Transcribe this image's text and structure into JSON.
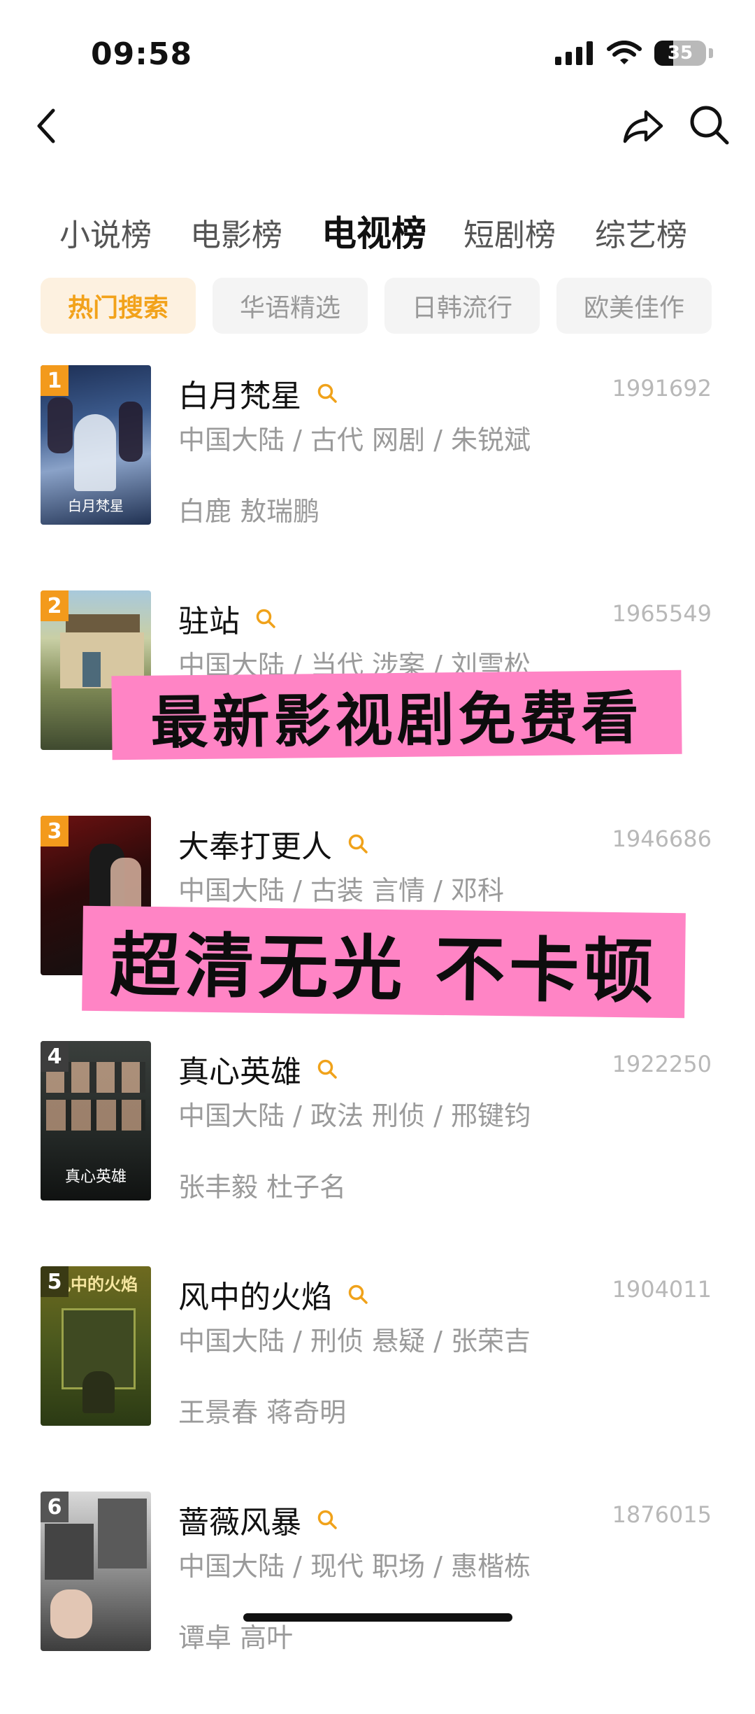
{
  "status_bar": {
    "time": "09:58",
    "battery": "35"
  },
  "nav": {
    "back_icon": "chevron-left-icon",
    "share_icon": "share-icon",
    "search_icon": "search-icon"
  },
  "main_tabs": [
    {
      "label": "小说榜",
      "active": false
    },
    {
      "label": "电影榜",
      "active": false
    },
    {
      "label": "电视榜",
      "active": true
    },
    {
      "label": "短剧榜",
      "active": false
    },
    {
      "label": "综艺榜",
      "active": false
    }
  ],
  "sub_tabs": [
    {
      "label": "热门搜索",
      "active": true
    },
    {
      "label": "华语精选",
      "active": false
    },
    {
      "label": "日韩流行",
      "active": false
    },
    {
      "label": "欧美佳作",
      "active": false
    }
  ],
  "items": [
    {
      "rank": "1",
      "title": "白月梵星",
      "count": "1991692",
      "meta": "中国大陆 / 古代 网剧 / 朱锐斌",
      "cast": "白鹿 敖瑞鹏",
      "poster_text": "白月梵星"
    },
    {
      "rank": "2",
      "title": "驻站",
      "count": "1965549",
      "meta": "中国大陆 / 当代 涉案 / 刘雪松",
      "cast": "",
      "poster_text": ""
    },
    {
      "rank": "3",
      "title": "大奉打更人",
      "count": "1946686",
      "meta": "中国大陆 / 古装 言情 / 邓科",
      "cast": "",
      "poster_text": ""
    },
    {
      "rank": "4",
      "title": "真心英雄",
      "count": "1922250",
      "meta": "中国大陆 / 政法 刑侦 / 邢键钧",
      "cast": "张丰毅 杜子名",
      "poster_text": "真心英雄"
    },
    {
      "rank": "5",
      "title": "风中的火焰",
      "count": "1904011",
      "meta": "中国大陆 / 刑侦 悬疑 / 张荣吉",
      "cast": "王景春 蒋奇明",
      "poster_text": "风中的火焰"
    },
    {
      "rank": "6",
      "title": "蔷薇风暴",
      "count": "1876015",
      "meta": "中国大陆 / 现代 职场 / 惠楷栋",
      "cast": "谭卓 高叶",
      "poster_text": ""
    }
  ],
  "overlay": {
    "banner_1": "最新影视剧免费看",
    "banner_2": "超清无光 不卡顿",
    "color": "#ff84c5"
  },
  "colors": {
    "accent": "#f39a1c",
    "muted": "#9a9a9a"
  }
}
